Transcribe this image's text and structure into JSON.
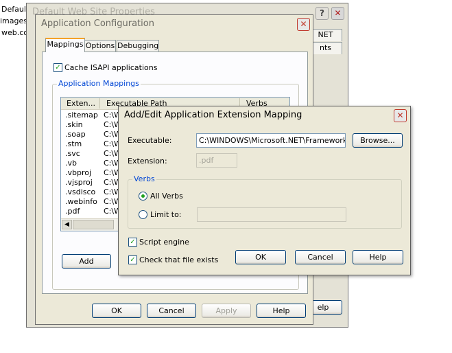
{
  "background_files": [
    "Default.a",
    "images.a",
    "web.con"
  ],
  "back_window": {
    "title": "Default Web Site Properties",
    "tab_fragments": [
      "NET",
      "nts"
    ],
    "help_label": "elp"
  },
  "app_config": {
    "title": "Application Configuration",
    "tabs": [
      {
        "label": "Mappings",
        "active": true
      },
      {
        "label": "Options",
        "active": false
      },
      {
        "label": "Debugging",
        "active": false
      }
    ],
    "cache_isapi_label": "Cache ISAPI applications",
    "cache_isapi_checked": true,
    "mappings_group": "Application Mappings",
    "columns": [
      "Exten...",
      "Executable Path",
      "Verbs"
    ],
    "rows": [
      {
        "ext": ".sitemap",
        "path": "C:\\W"
      },
      {
        "ext": ".skin",
        "path": "C:\\W"
      },
      {
        "ext": ".soap",
        "path": "C:\\W"
      },
      {
        "ext": ".stm",
        "path": "C:\\W"
      },
      {
        "ext": ".svc",
        "path": "C:\\W"
      },
      {
        "ext": ".vb",
        "path": "C:\\W"
      },
      {
        "ext": ".vbproj",
        "path": "C:\\W"
      },
      {
        "ext": ".vjsproj",
        "path": "C:\\W"
      },
      {
        "ext": ".vsdisco",
        "path": "C:\\W"
      },
      {
        "ext": ".webinfo",
        "path": "C:\\W"
      },
      {
        "ext": ".pdf",
        "path": "C:\\W"
      }
    ],
    "add_label": "Add",
    "ok_label": "OK",
    "cancel_label": "Cancel",
    "apply_label": "Apply",
    "help_label": "Help"
  },
  "mapping_dialog": {
    "title": "Add/Edit Application Extension Mapping",
    "executable_label": "Executable:",
    "executable_value": "C:\\WINDOWS\\Microsoft.NET\\Framework\\v",
    "browse_label": "Browse...",
    "extension_label": "Extension:",
    "extension_value": ".pdf",
    "verbs_group": "Verbs",
    "all_verbs_label": "All Verbs",
    "all_verbs_selected": true,
    "limit_to_label": "Limit to:",
    "limit_to_value": "",
    "script_engine_label": "Script engine",
    "script_engine_checked": true,
    "check_file_label": "Check that file exists",
    "check_file_checked": true,
    "ok_label": "OK",
    "cancel_label": "Cancel",
    "help_label": "Help"
  },
  "colors": {
    "dialog_bg": "#ece9d8",
    "button_border": "#003c74",
    "group_label": "#0046d5",
    "check_mark": "#21a121",
    "close_red": "#c0392b"
  }
}
